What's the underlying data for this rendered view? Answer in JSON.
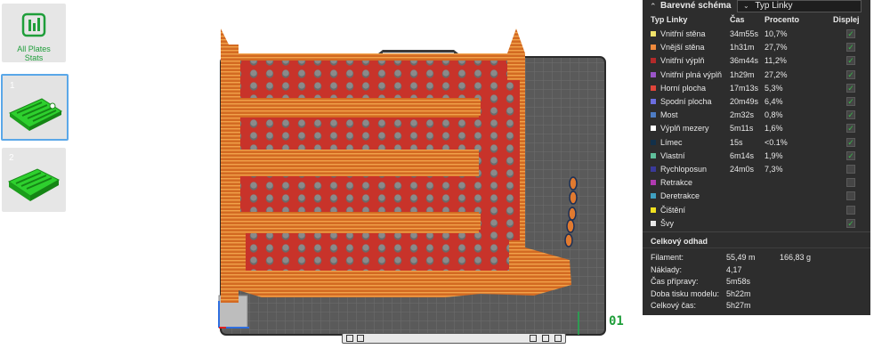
{
  "sidebar": {
    "all_plates_label_1": "All Plates",
    "all_plates_label_2": "Stats",
    "plates": [
      {
        "number": "1",
        "selected": true
      },
      {
        "number": "2",
        "selected": false
      }
    ]
  },
  "viewport": {
    "plate_label": "01"
  },
  "panel": {
    "scheme_title": "Barevné schéma",
    "scheme_select_value": "Typ Linky",
    "columns": {
      "type": "Typ Linky",
      "time": "Čas",
      "percent": "Procento",
      "display": "Displej"
    },
    "rows": [
      {
        "name": "Vnitřní stěna",
        "time": "34m55s",
        "percent": "10,7%",
        "color": "#f0e26a",
        "checked": true
      },
      {
        "name": "Vnější stěna",
        "time": "1h31m",
        "percent": "27,7%",
        "color": "#f08a3c",
        "checked": true
      },
      {
        "name": "Vnitřní výplň",
        "time": "36m44s",
        "percent": "11,2%",
        "color": "#b32a2a",
        "checked": true
      },
      {
        "name": "Vnitřní plná výplň",
        "time": "1h29m",
        "percent": "27,2%",
        "color": "#9b55c9",
        "checked": true
      },
      {
        "name": "Horní plocha",
        "time": "17m13s",
        "percent": "5,3%",
        "color": "#e0453a",
        "checked": true
      },
      {
        "name": "Spodní plocha",
        "time": "20m49s",
        "percent": "6,4%",
        "color": "#6c6ee0",
        "checked": true
      },
      {
        "name": "Most",
        "time": "2m32s",
        "percent": "0,8%",
        "color": "#4d7cc4",
        "checked": true
      },
      {
        "name": "Výplň mezery",
        "time": "5m11s",
        "percent": "1,6%",
        "color": "#ffffff",
        "checked": true
      },
      {
        "name": "Límec",
        "time": "15s",
        "percent": "<0.1%",
        "color": "#12304a",
        "checked": true
      },
      {
        "name": "Vlastní",
        "time": "6m14s",
        "percent": "1,9%",
        "color": "#5fbf9b",
        "checked": true
      },
      {
        "name": "Rychloposun",
        "time": "24m0s",
        "percent": "7,3%",
        "color": "#3a3a9a",
        "checked": false
      },
      {
        "name": "Retrakce",
        "time": "",
        "percent": "",
        "color": "#b03ab0",
        "checked": false
      },
      {
        "name": "Deretrakce",
        "time": "",
        "percent": "",
        "color": "#3fa0c0",
        "checked": false
      },
      {
        "name": "Čištění",
        "time": "",
        "percent": "",
        "color": "#f0e020",
        "checked": false
      },
      {
        "name": "Švy",
        "time": "",
        "percent": "",
        "color": "#e8e8e8",
        "checked": true
      }
    ],
    "summary_title": "Celkový odhad",
    "summary": [
      {
        "label": "Filament:",
        "value": "55,49 m",
        "value2": "166,83 g"
      },
      {
        "label": "Náklady:",
        "value": "4,17",
        "value2": ""
      },
      {
        "label": "Čas přípravy:",
        "value": "5m58s",
        "value2": ""
      },
      {
        "label": "Doba tisku modelu:",
        "value": "5h22m",
        "value2": ""
      },
      {
        "label": "Celkový čas:",
        "value": "5h27m",
        "value2": ""
      }
    ]
  }
}
